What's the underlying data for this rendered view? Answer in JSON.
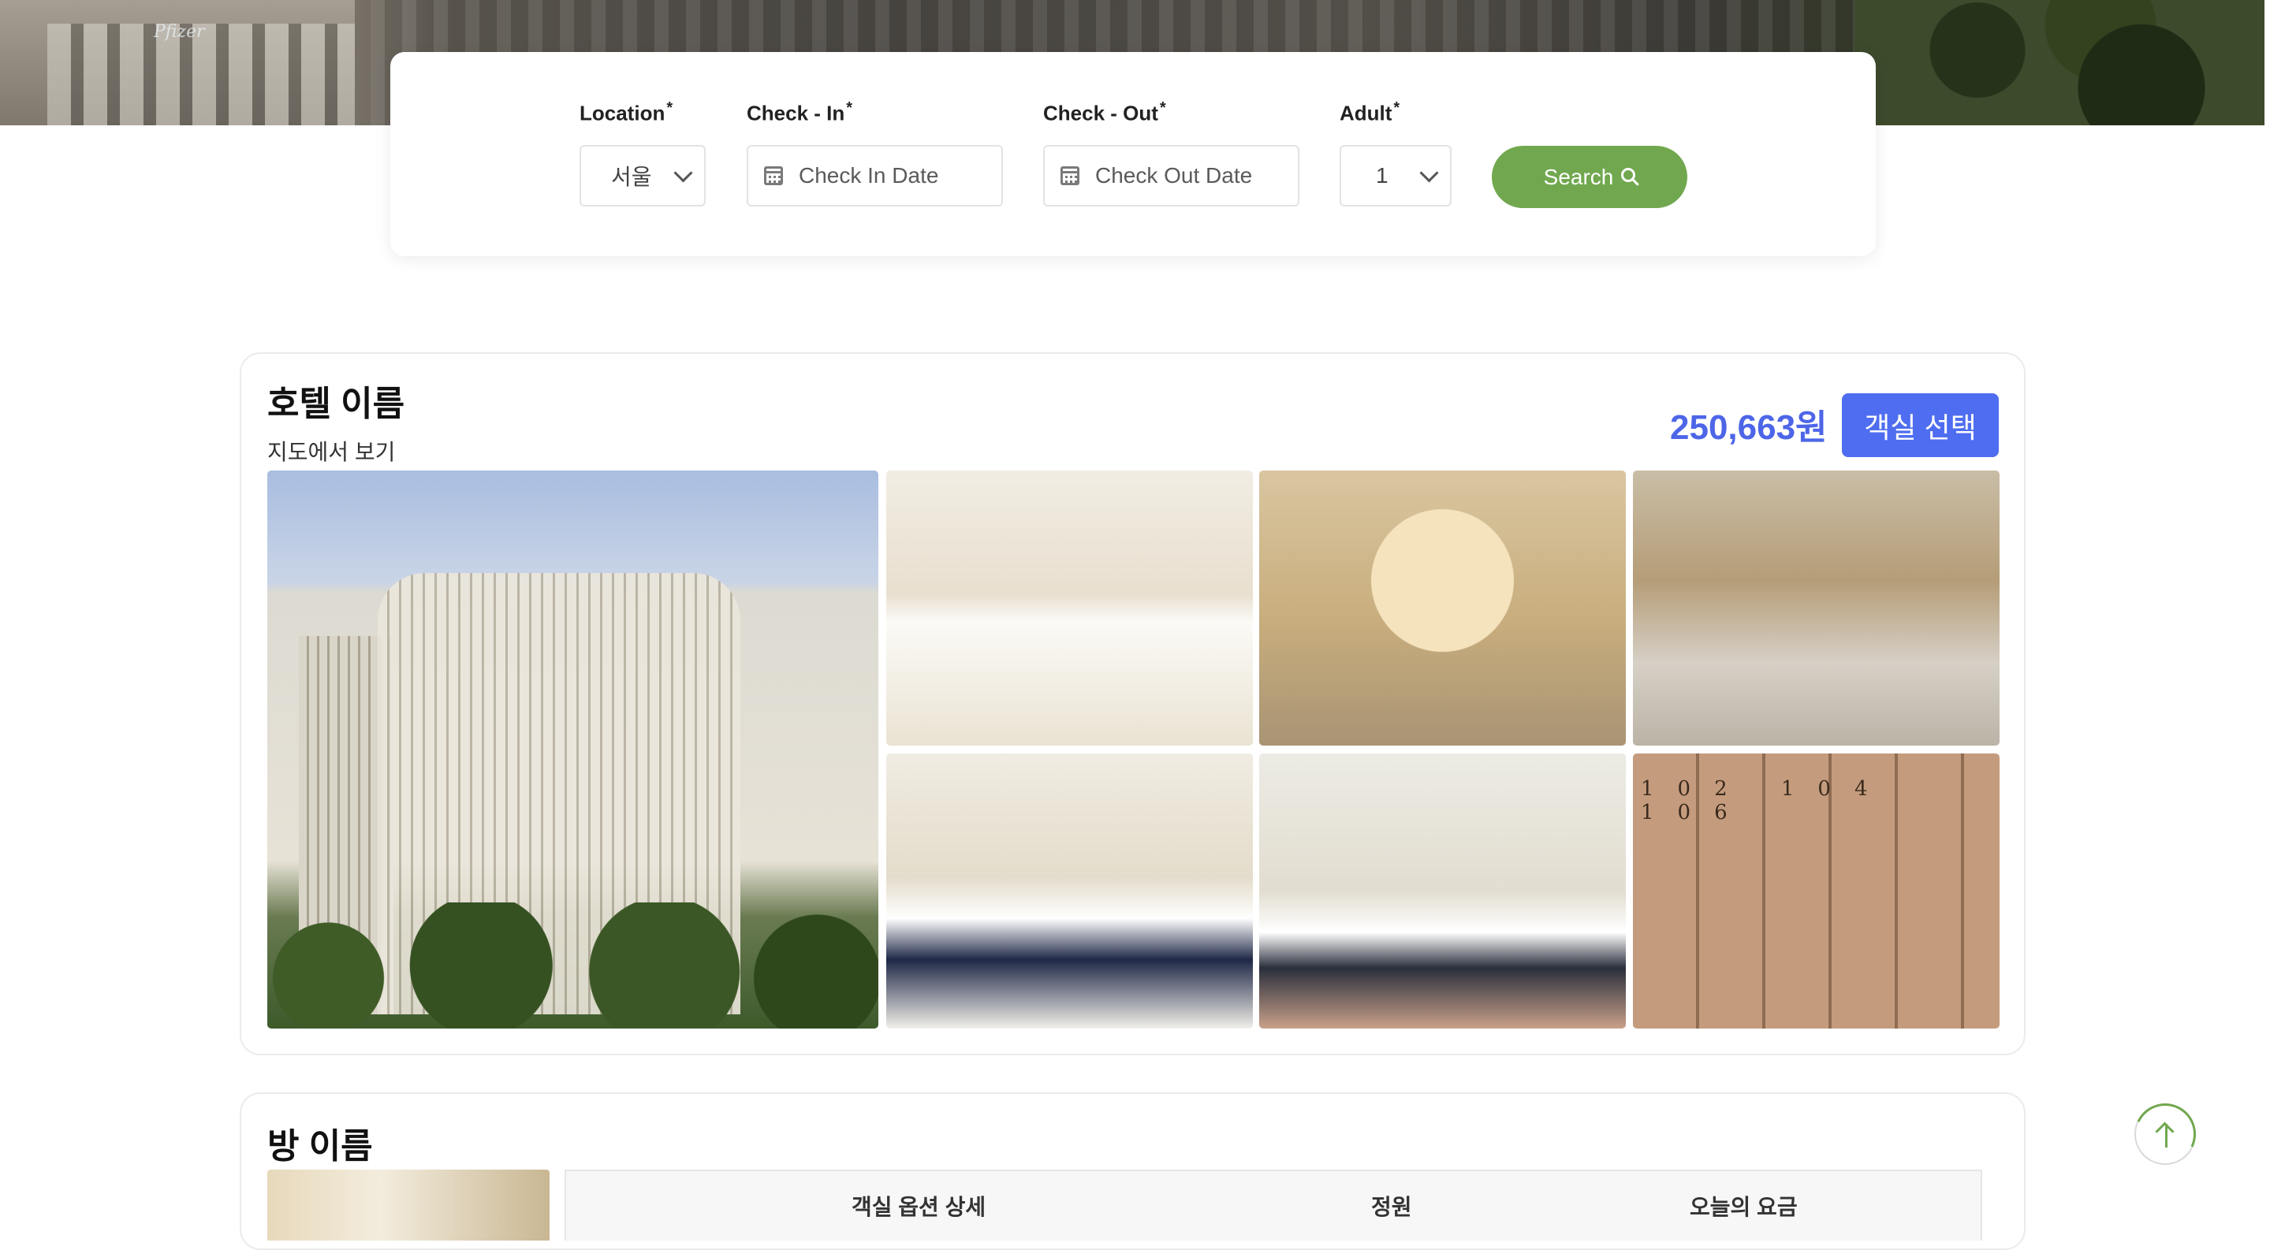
{
  "hero": {
    "logo_text": "Pfizer"
  },
  "search": {
    "location_label": "Location",
    "checkin_label": "Check - In",
    "checkout_label": "Check - Out",
    "adult_label": "Adult",
    "required_mark": "*",
    "location_value": "서울",
    "checkin_placeholder": "Check In Date",
    "checkout_placeholder": "Check Out Date",
    "adult_value": "1",
    "button_label": "Search"
  },
  "hotel": {
    "name": "호텔 이름",
    "map_link": "지도에서 보기",
    "price": "250,663원",
    "select_button": "객실 선택",
    "locker_numbers": "102 104 106"
  },
  "room": {
    "name": "방 이름",
    "columns": [
      "객실 옵션 상세",
      "정원",
      "오늘의 요금"
    ]
  },
  "colors": {
    "accent_green": "#71a84f",
    "accent_blue": "#4f6df0",
    "price_blue": "#4d66e8"
  },
  "icons": [
    "calendar-icon",
    "search-icon",
    "chevron-down-icon",
    "arrow-up-icon"
  ]
}
